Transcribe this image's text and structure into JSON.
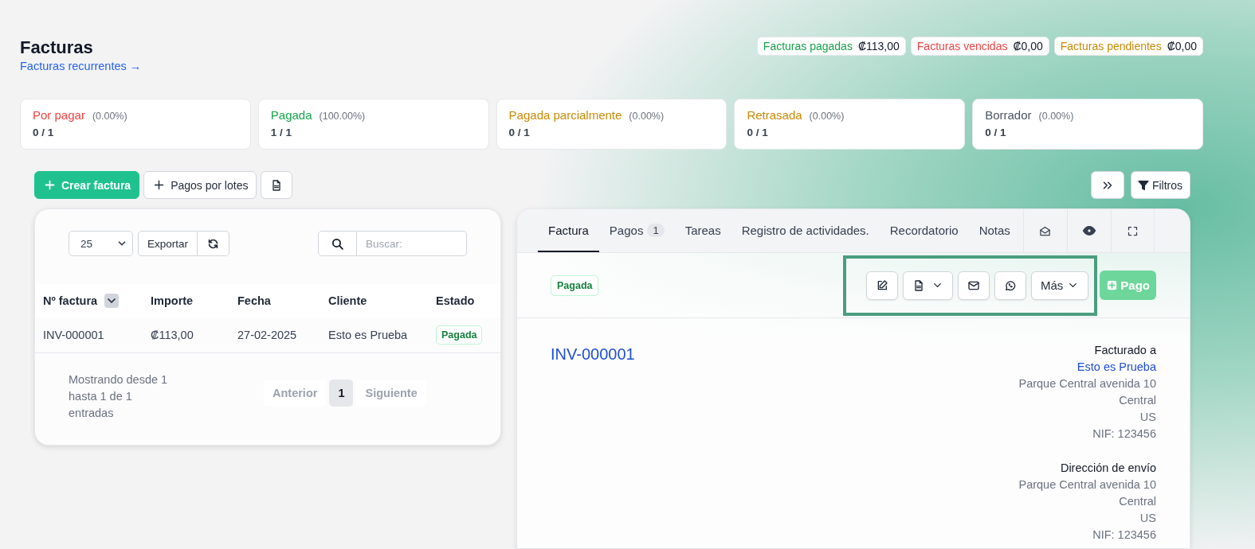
{
  "page": {
    "title": "Facturas",
    "link": "Facturas recurrentes →"
  },
  "summary": [
    {
      "label": "Facturas pagadas",
      "amount": "₡113,00",
      "color": "#16a34a"
    },
    {
      "label": "Facturas vencidas",
      "amount": "₡0,00",
      "color": "#ef4444"
    },
    {
      "label": "Facturas pendientes",
      "amount": "₡0,00",
      "color": "#ca8a04"
    }
  ],
  "status_cards": [
    {
      "label": "Por pagar",
      "percent": "(0.00%)",
      "count": "0 / 1",
      "color": "#ef4444"
    },
    {
      "label": "Pagada",
      "percent": "(100.00%)",
      "count": "1 / 1",
      "color": "#16a34a"
    },
    {
      "label": "Pagada parcialmente",
      "percent": "(0.00%)",
      "count": "0 / 1",
      "color": "#ca8a04"
    },
    {
      "label": "Retrasada",
      "percent": "(0.00%)",
      "count": "0 / 1",
      "color": "#ca8a04"
    },
    {
      "label": "Borrador",
      "percent": "(0.00%)",
      "count": "0 / 1",
      "color": "#4b5563"
    }
  ],
  "toolbar": {
    "create_button": "Crear factura",
    "batch_button": "Pagos por lotes",
    "filters_button": "Filtros"
  },
  "invoice_list": {
    "page_size": "25",
    "export_button": "Exportar",
    "search": {
      "placeholder": "Buscar:"
    },
    "columns": [
      "Nº factura",
      "Importe",
      "Fecha",
      "Cliente",
      "Estado"
    ],
    "rows": [
      {
        "number": "INV-000001",
        "amount": "₡113,00",
        "date": "27-02-2025",
        "client": "Esto es Prueba",
        "status": "Pagada"
      }
    ],
    "info": "Mostrando desde 1 hasta 1 de 1 entradas",
    "pagination": {
      "previous": "Anterior",
      "pages": [
        {
          "label": "1",
          "selected": true
        }
      ],
      "next": "Siguiente"
    }
  },
  "detail": {
    "tabs": [
      {
        "label": "Factura",
        "selected": true
      },
      {
        "label": "Pagos",
        "badge": "1",
        "selected": false
      },
      {
        "label": "Tareas",
        "selected": false
      },
      {
        "label": "Registro de actividades.",
        "selected": false
      },
      {
        "label": "Recordatorio",
        "selected": false
      },
      {
        "label": "Notas",
        "selected": false
      }
    ],
    "status": "Pagada",
    "more_button": "Más",
    "payment_button": "Pago",
    "number": "INV-000001",
    "billed_to": {
      "heading": "Facturado a",
      "client": "Esto es Prueba",
      "lines": [
        "Parque Central avenida 10",
        "Central",
        "US",
        "NIF: 123456"
      ]
    },
    "shipping": {
      "heading": "Dirección de envío",
      "lines": [
        "Parque Central avenida 10",
        "Central",
        "US",
        "NIF: 123456"
      ]
    }
  }
}
